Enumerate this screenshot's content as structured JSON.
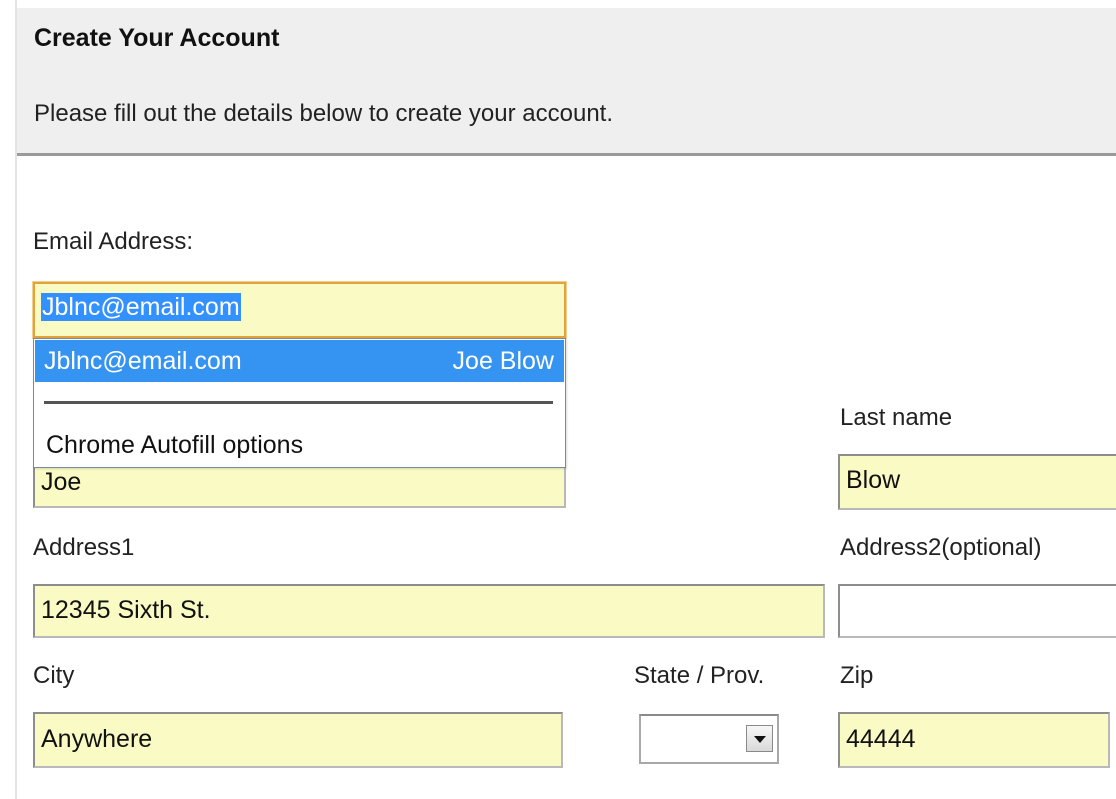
{
  "header": {
    "title": "Create Your Account",
    "subtitle": "Please fill out the details below to create your account."
  },
  "form": {
    "email": {
      "label": "Email Address:",
      "value": "Jblnc@email.com"
    },
    "first_name": {
      "value": "Joe"
    },
    "last_name": {
      "label": "Last name",
      "value": "Blow"
    },
    "address1": {
      "label": "Address1",
      "value": "12345 Sixth St."
    },
    "address2": {
      "label": "Address2(optional)",
      "value": ""
    },
    "city": {
      "label": "City",
      "value": "Anywhere"
    },
    "state": {
      "label": "State / Prov.",
      "value": ""
    },
    "zip": {
      "label": "Zip",
      "value": "44444"
    }
  },
  "autofill": {
    "suggestion_email": "Jblnc@email.com",
    "suggestion_name": "Joe Blow",
    "options_label": "Chrome Autofill options"
  },
  "colors": {
    "autofill_field": "#fafbc4",
    "selection": "#3390ff",
    "dropdown_highlight": "#3593f2",
    "header_bg": "#efefef",
    "focus_border": "#e2a23c"
  }
}
